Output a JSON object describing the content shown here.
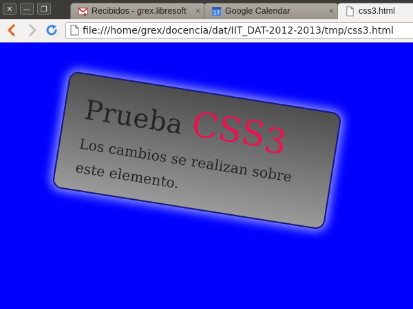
{
  "window_controls": {
    "close": "✕",
    "minimize": "—",
    "restore": "❐"
  },
  "tabs": [
    {
      "label": "Recibidos - grex.libresoftw",
      "close": "×",
      "badge": "0"
    },
    {
      "label": "Google Calendar",
      "close": "×",
      "badge": "17"
    },
    {
      "label": "css3.html"
    }
  ],
  "toolbar": {
    "url": "file:///home/grex/docencia/dat/IIT_DAT-2012-2013/tmp/css3.html"
  },
  "page": {
    "heading_prefix": "Prueba ",
    "heading_highlight_letters": "CSS",
    "heading_highlight_digit": "3",
    "paragraph": "Los cambios se realizan sobre este elemento."
  },
  "colors": {
    "page_background": "#0000ff",
    "highlight": "#e8144e",
    "card_glow": "#8f98ff"
  }
}
